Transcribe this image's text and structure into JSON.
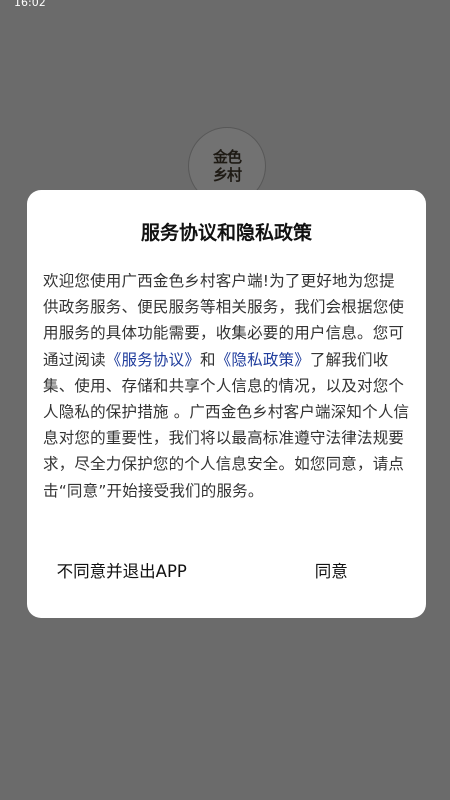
{
  "status_bar": {
    "time": "16:02"
  },
  "logo": {
    "line1": "金色",
    "line2": "乡村"
  },
  "dialog": {
    "title": "服务协议和隐私政策",
    "body_part1": "欢迎您使用广西金色乡村客户端!为了更好地为您提供政务服务、便民服务等相关服务，我们会根据您使用服务的具体功能需要，收集必要的用户信息。您可通过阅读",
    "link_service": "《服务协议》",
    "body_and": "和",
    "link_privacy": "《隐私政策》",
    "body_part2": "了解我们收集、使用、存储和共享个人信息的情况，以及对您个人隐私的保护措施 。广西金色乡村客户端深知个人信息对您的重要性，我们将以最高标准遵守法律法规要求，尽全力保护您的个人信息安全。如您同意，请点击“同意”开始接受我们的服务。",
    "reject_label": "不同意并退出APP",
    "agree_label": "同意"
  },
  "colors": {
    "overlay": "#6b6b6b",
    "dialog_bg": "#ffffff",
    "link": "#1f3c9c",
    "text": "#333333"
  }
}
